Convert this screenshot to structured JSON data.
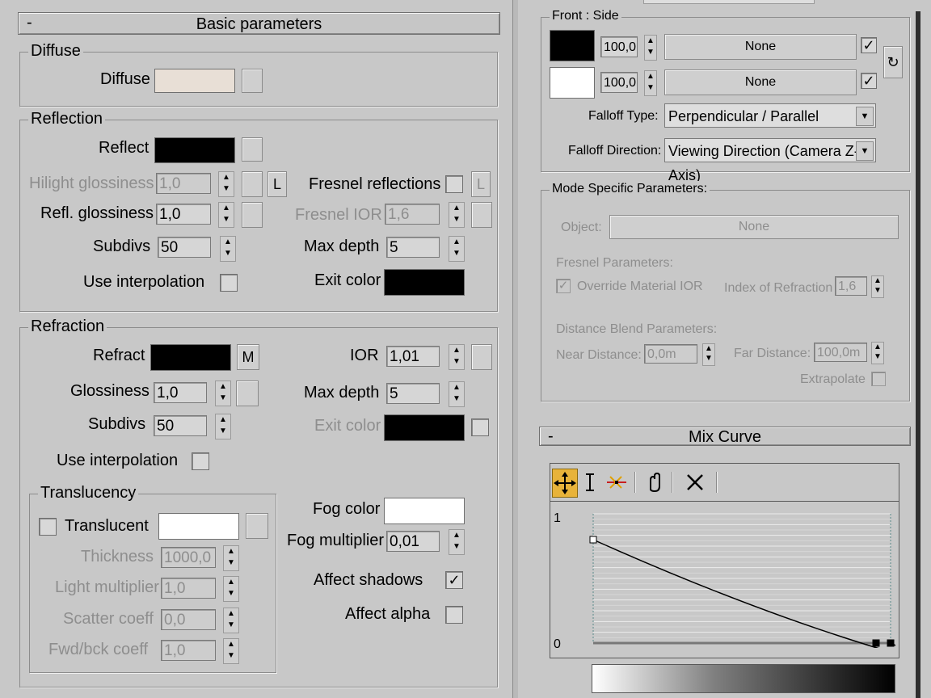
{
  "basic": {
    "title": "Basic parameters",
    "collapse": "-",
    "diffuse": {
      "group": "Diffuse",
      "label": "Diffuse",
      "color": "#e8dfd6"
    },
    "reflection": {
      "group": "Reflection",
      "reflect": "Reflect",
      "reflect_color": "#000000",
      "hilight": "Hilight glossiness",
      "hilight_val": "1,0",
      "l_btn": "L",
      "fresnel": "Fresnel reflections",
      "fresnel_l": "L",
      "refl_gloss": "Refl. glossiness",
      "refl_gloss_val": "1,0",
      "fresnel_ior": "Fresnel IOR",
      "fresnel_ior_val": "1,6",
      "subdivs": "Subdivs",
      "subdivs_val": "50",
      "max_depth": "Max depth",
      "max_depth_val": "5",
      "use_interp": "Use interpolation",
      "exit_color": "Exit color",
      "exit_color_val": "#000000"
    },
    "refraction": {
      "group": "Refraction",
      "refract": "Refract",
      "refract_color": "#000000",
      "m_btn": "M",
      "ior": "IOR",
      "ior_val": "1,01",
      "gloss": "Glossiness",
      "gloss_val": "1,0",
      "max_depth": "Max depth",
      "max_depth_val": "5",
      "subdivs": "Subdivs",
      "subdivs_val": "50",
      "exit_color": "Exit color",
      "exit_color_val": "#000000",
      "use_interp": "Use interpolation",
      "fog_color": "Fog color",
      "fog_color_val": "#ffffff",
      "fog_mult": "Fog multiplier",
      "fog_mult_val": "0,01",
      "affect_shadows": "Affect shadows",
      "affect_shadows_check": "✓",
      "affect_alpha": "Affect alpha"
    },
    "translucency": {
      "group": "Translucency",
      "translucent": "Translucent",
      "trans_color": "#ffffff",
      "thickness": "Thickness",
      "thickness_val": "1000,0",
      "light_mult": "Light multiplier",
      "light_mult_val": "1,0",
      "scatter": "Scatter coeff",
      "scatter_val": "0,0",
      "fwd": "Fwd/bck coeff",
      "fwd_val": "1,0"
    }
  },
  "falloff": {
    "front_side": "Front : Side",
    "front_color": "#000000",
    "front_val": "100,0",
    "front_map": "None",
    "front_check": "✓",
    "side_color": "#ffffff",
    "side_val": "100,0",
    "side_map": "None",
    "side_check": "✓",
    "swap_icon": "↻",
    "type_label": "Falloff Type:",
    "type_val": "Perpendicular / Parallel",
    "dir_label": "Falloff Direction:",
    "dir_val": "Viewing Direction (Camera Z-Axis)",
    "dd_arrow": "▼"
  },
  "mode": {
    "title": "Mode Specific Parameters:",
    "object": "Object:",
    "object_val": "None",
    "fresnel_params": "Fresnel Parameters:",
    "override": "Override Material IOR",
    "override_check": "✓",
    "ior": "Index of Refraction",
    "ior_val": "1,6",
    "distance_params": "Distance Blend Parameters:",
    "near": "Near Distance:",
    "near_val": "0,0m",
    "far": "Far Distance:",
    "far_val": "100,0m",
    "extrapolate": "Extrapolate"
  },
  "mix": {
    "title": "Mix Curve",
    "collapse": "-",
    "y_top": "1",
    "y_bottom": "0",
    "tools": [
      "move-icon",
      "scale-icon",
      "insert-point-icon",
      "pan-icon",
      "delete-icon"
    ],
    "curve": {
      "points": [
        [
          0.0,
          0.8
        ],
        [
          0.45,
          0.4
        ],
        [
          1.0,
          0.0
        ]
      ]
    }
  }
}
